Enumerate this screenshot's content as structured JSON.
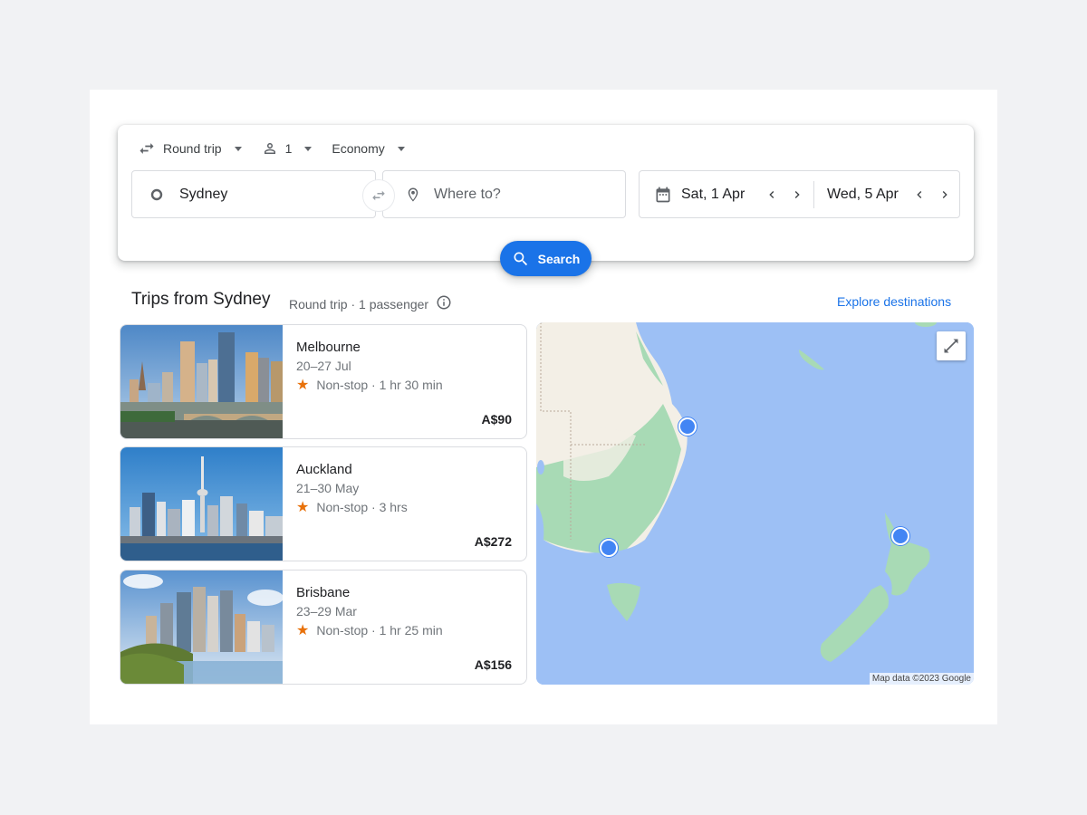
{
  "search": {
    "trip_type": "Round trip",
    "passengers": "1",
    "cabin_class": "Economy",
    "origin": "Sydney",
    "destination_placeholder": "Where to?",
    "depart_date": "Sat, 1 Apr",
    "return_date": "Wed, 5 Apr",
    "search_label": "Search"
  },
  "trips": {
    "title": "Trips from Sydney",
    "subtitle": "Round trip · 1 passenger",
    "explore_link": "Explore destinations",
    "items": [
      {
        "city": "Melbourne",
        "dates": "20–27 Jul",
        "stops": "Non-stop · 1 hr 30 min",
        "price": "A$90"
      },
      {
        "city": "Auckland",
        "dates": "21–30 May",
        "stops": "Non-stop · 3 hrs",
        "price": "A$272"
      },
      {
        "city": "Brisbane",
        "dates": "23–29 Mar",
        "stops": "Non-stop · 1 hr 25 min",
        "price": "A$156"
      }
    ]
  },
  "map": {
    "attribution": "Map data ©2023 Google",
    "pins": [
      "Brisbane",
      "Melbourne",
      "Auckland"
    ]
  },
  "colors": {
    "accent": "#1a73e8",
    "star": "#e8710a",
    "water": "#9dc0f5",
    "land": "#f3efe6",
    "green": "#a8dab5"
  }
}
